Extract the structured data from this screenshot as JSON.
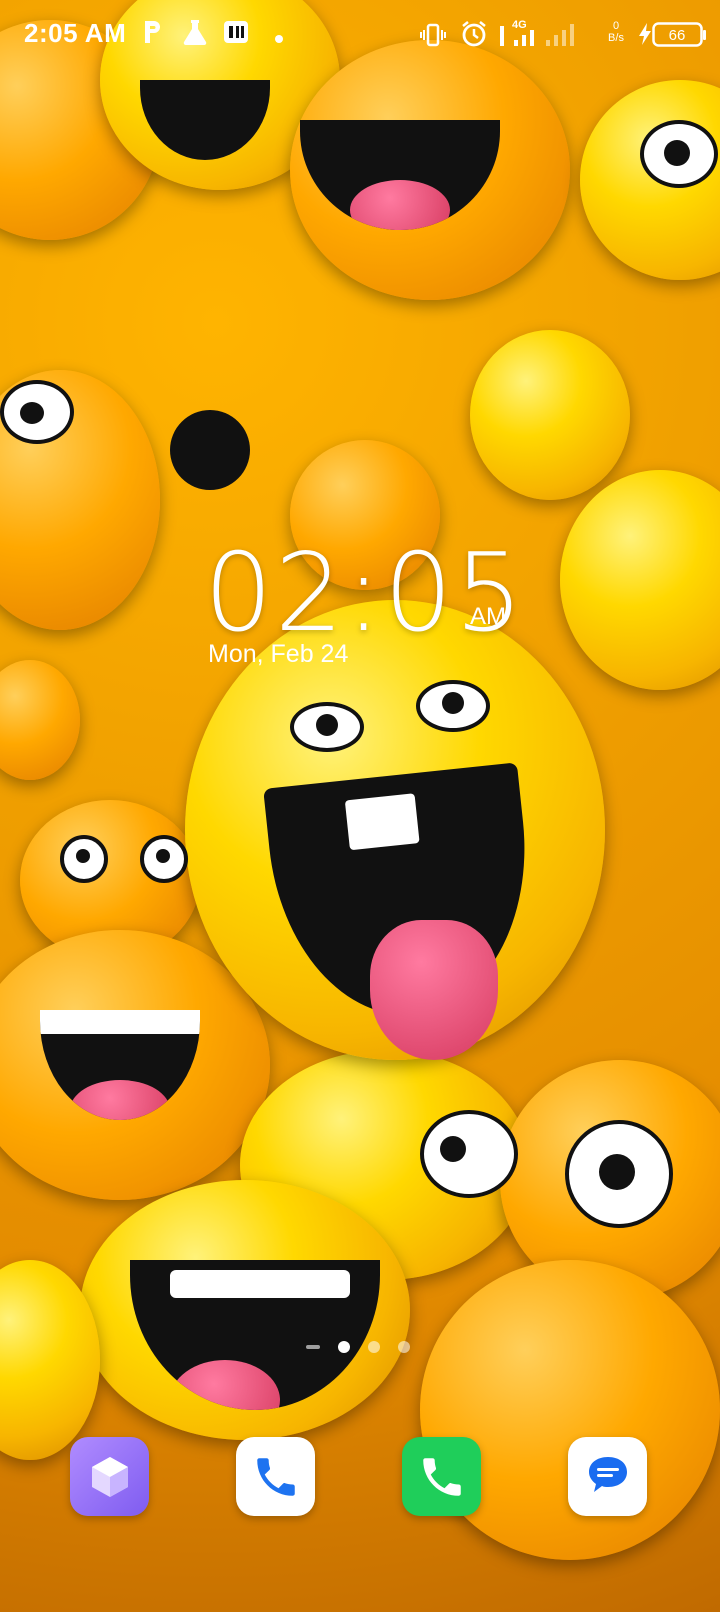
{
  "status_bar": {
    "time": "2:05 AM",
    "network_type": "4G",
    "data_speed_value": "0",
    "data_speed_unit": "B/s",
    "battery_level": "66",
    "icons": [
      "parking-p-icon",
      "flask-icon",
      "sim-app-icon",
      "dot-icon",
      "vibrate-icon",
      "alarm-icon",
      "signal-icon",
      "charging-icon",
      "battery-icon"
    ]
  },
  "clock": {
    "time": "02:05",
    "ampm": "AM",
    "date": "Mon, Feb 24"
  },
  "pager": {
    "pages": 3,
    "active_index": 0
  },
  "dock": {
    "apps": [
      {
        "name": "cube-app",
        "color": "#9b7bff"
      },
      {
        "name": "phone-dialer",
        "color": "#ffffff"
      },
      {
        "name": "phone-call",
        "color": "#1fce5a"
      },
      {
        "name": "messages",
        "color": "#ffffff"
      }
    ]
  }
}
